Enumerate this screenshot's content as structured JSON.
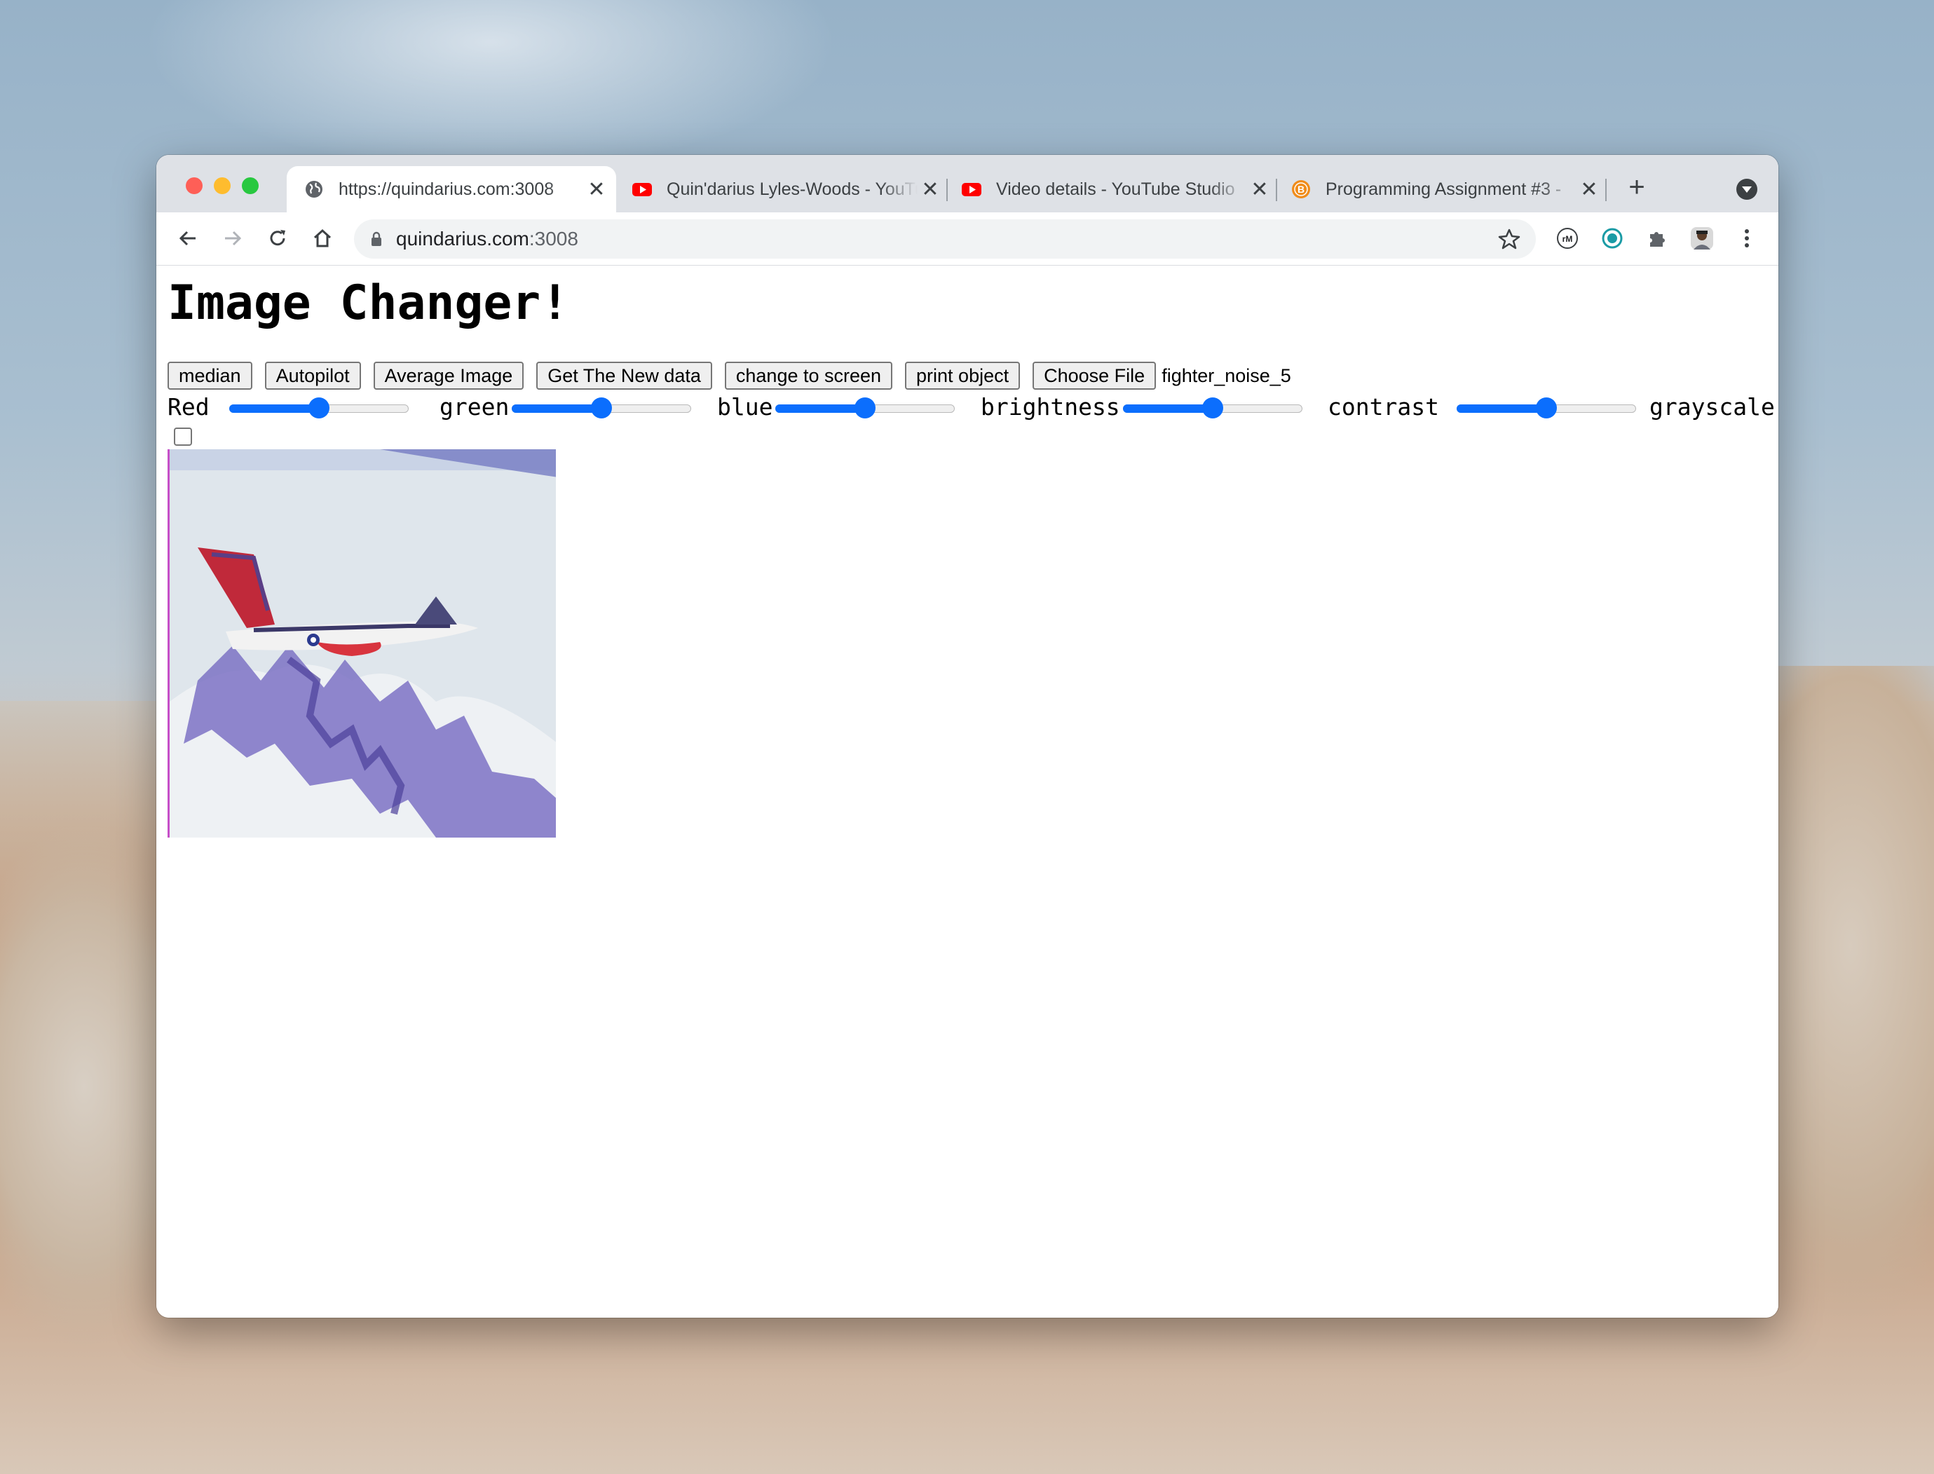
{
  "browser": {
    "tabs": [
      {
        "title": "https://quindarius.com:3008",
        "favicon": "globe-icon",
        "active": true
      },
      {
        "title": "Quin'darius Lyles-Woods - YouTube",
        "favicon": "youtube-icon",
        "active": false
      },
      {
        "title": "Video details - YouTube Studio",
        "favicon": "youtube-icon",
        "active": false
      },
      {
        "title": "Programming Assignment #3 -",
        "favicon": "b-icon",
        "active": false
      }
    ],
    "address": {
      "host": "quindarius.com",
      "port": ":3008"
    },
    "colors": {
      "accent": "#0b6efd",
      "youtube": "#ff0000",
      "tab_strip": "#dee1e6"
    }
  },
  "page": {
    "title": "Image Changer!",
    "buttons": {
      "median": "median",
      "autopilot": "Autopilot",
      "average": "Average Image",
      "get_new": "Get The New data",
      "change_screen": "change to screen",
      "print_object": "print object",
      "choose_file": "Choose File"
    },
    "file_name": "fighter_noise_5",
    "sliders": {
      "red": {
        "label": "Red",
        "value": 0.5
      },
      "green": {
        "label": "green",
        "value": 0.5
      },
      "blue": {
        "label": "blue",
        "value": 0.5
      },
      "brightness": {
        "label": "brightness",
        "value": 0.5
      },
      "contrast": {
        "label": "contrast",
        "value": 0.5
      }
    },
    "grayscale": {
      "label": "grayscale",
      "checked": false
    }
  }
}
